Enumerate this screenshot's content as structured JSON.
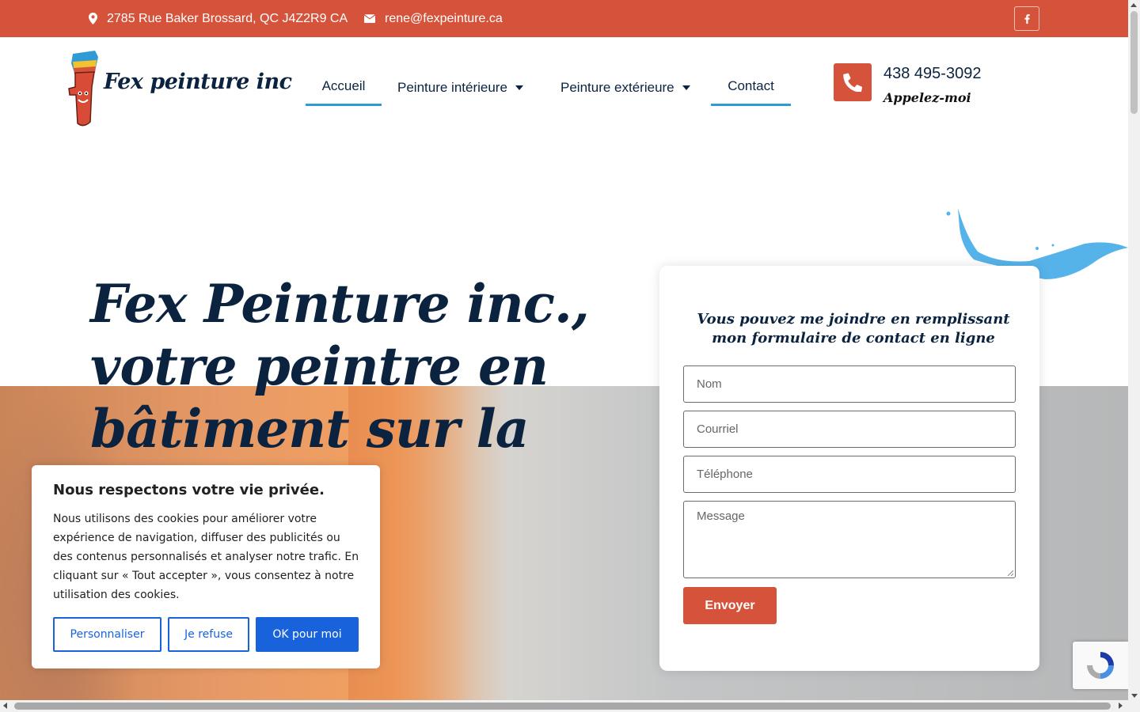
{
  "topbar": {
    "address": "2785 Rue Baker Brossard, QC J4Z2R9 CA",
    "email": "rene@fexpeinture.ca",
    "social_icon": "facebook-icon"
  },
  "header": {
    "logo_text": "Fex peinture inc",
    "nav": [
      {
        "label": "Accueil"
      },
      {
        "label": "Peinture intérieure"
      },
      {
        "label": "Peinture extérieure"
      },
      {
        "label": "Contact"
      }
    ],
    "phone_number": "438 495-3092",
    "phone_caption": "Appelez-moi"
  },
  "hero": {
    "title_line1": "Fex Peinture inc.,",
    "title_line2": "votre peintre en",
    "title_line3": "bâtiment sur la"
  },
  "form": {
    "heading": "Vous pouvez me joindre en remplissant mon formulaire de contact en ligne",
    "name_placeholder": "Nom",
    "email_placeholder": "Courriel",
    "phone_placeholder": "Téléphone",
    "message_placeholder": "Message",
    "submit_label": "Envoyer"
  },
  "cookie": {
    "title": "Nous respectons votre vie privée.",
    "text": "Nous utilisons des cookies pour améliorer votre expérience de navigation, diffuser des publicités ou des contenus personnalisés et analyser notre trafic. En cliquant sur « Tout accepter », vous consentez à notre utilisation des cookies.",
    "customize_label": "Personnaliser",
    "reject_label": "Je refuse",
    "accept_label": "OK pour moi"
  },
  "colors": {
    "brand_orange": "#d5533b",
    "navy": "#0c2340",
    "accent_blue": "#2e9bd6",
    "cookie_blue": "#1863dc"
  }
}
